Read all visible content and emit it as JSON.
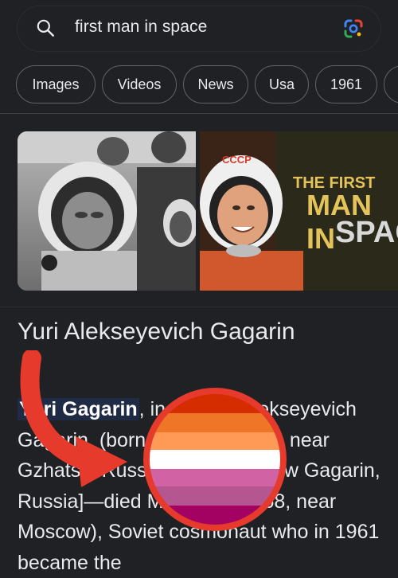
{
  "search": {
    "query": "first man in space",
    "search_icon": "search-icon",
    "lens_icon": "google-lens-icon"
  },
  "chips": [
    {
      "label": "Images"
    },
    {
      "label": "Videos"
    },
    {
      "label": "News"
    },
    {
      "label": "Usa"
    },
    {
      "label": "1961"
    }
  ],
  "images": {
    "overlay_line1": "THE FIRST",
    "overlay_line2": "MAN IN",
    "overlay_line3": "SPAC"
  },
  "entity": {
    "title": "Yuri Alekseyevich Gagarin",
    "desc_highlight": "Yuri Gagarin",
    "desc_rest": ", in full Yuri Alekseyevich Gagarin, (born March 9, 1934, near Gzhatsk, Russia, U.S.S.R. [now Gagarin, Russia]—died March 27, 1968, near Moscow), Soviet cosmonaut who in 1961 became the"
  },
  "overlay": {
    "flag_colors": [
      "#d52d00",
      "#ef7627",
      "#ff9a56",
      "#ffffff",
      "#d162a4",
      "#b55690",
      "#a30262"
    ],
    "arrow_color": "#e53a2c"
  }
}
